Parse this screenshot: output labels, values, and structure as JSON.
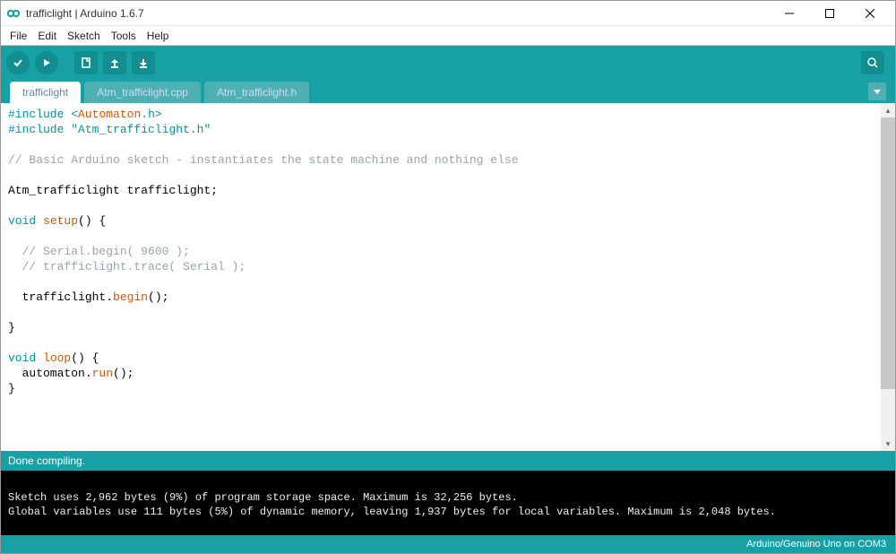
{
  "titlebar": {
    "title": "trafficlight | Arduino 1.6.7"
  },
  "menu": {
    "file": "File",
    "edit": "Edit",
    "sketch": "Sketch",
    "tools": "Tools",
    "help": "Help"
  },
  "tabs": {
    "items": [
      {
        "label": "trafficlight",
        "active": true
      },
      {
        "label": "Atm_trafficlight.cpp",
        "active": false
      },
      {
        "label": "Atm_trafficlight.h",
        "active": false
      }
    ]
  },
  "code": {
    "l01a": "#include",
    "l01b": "<",
    "l01c": "Automaton",
    "l01d": ".h>",
    "l02a": "#include",
    "l02b": "\"Atm_trafficlight.h\"",
    "l04": "// Basic Arduino sketch - instantiates the state machine and nothing else",
    "l06": "Atm_trafficlight trafficlight;",
    "l08a": "void",
    "l08b": "setup",
    "l08c": "() {",
    "l10": "  // Serial.begin( 9600 );",
    "l11": "  // trafficlight.trace( Serial );",
    "l13a": "  trafficlight.",
    "l13b": "begin",
    "l13c": "();",
    "l15": "}",
    "l17a": "void",
    "l17b": "loop",
    "l17c": "() {",
    "l18a": "  automaton.",
    "l18b": "run",
    "l18c": "();",
    "l19": "}"
  },
  "status": {
    "message": "Done compiling."
  },
  "console": {
    "line1": "Sketch uses 2,962 bytes (9%) of program storage space. Maximum is 32,256 bytes.",
    "line2": "Global variables use 111 bytes (5%) of dynamic memory, leaving 1,937 bytes for local variables. Maximum is 2,048 bytes."
  },
  "bottom": {
    "board": "Arduino/Genuino Uno on COM3"
  }
}
